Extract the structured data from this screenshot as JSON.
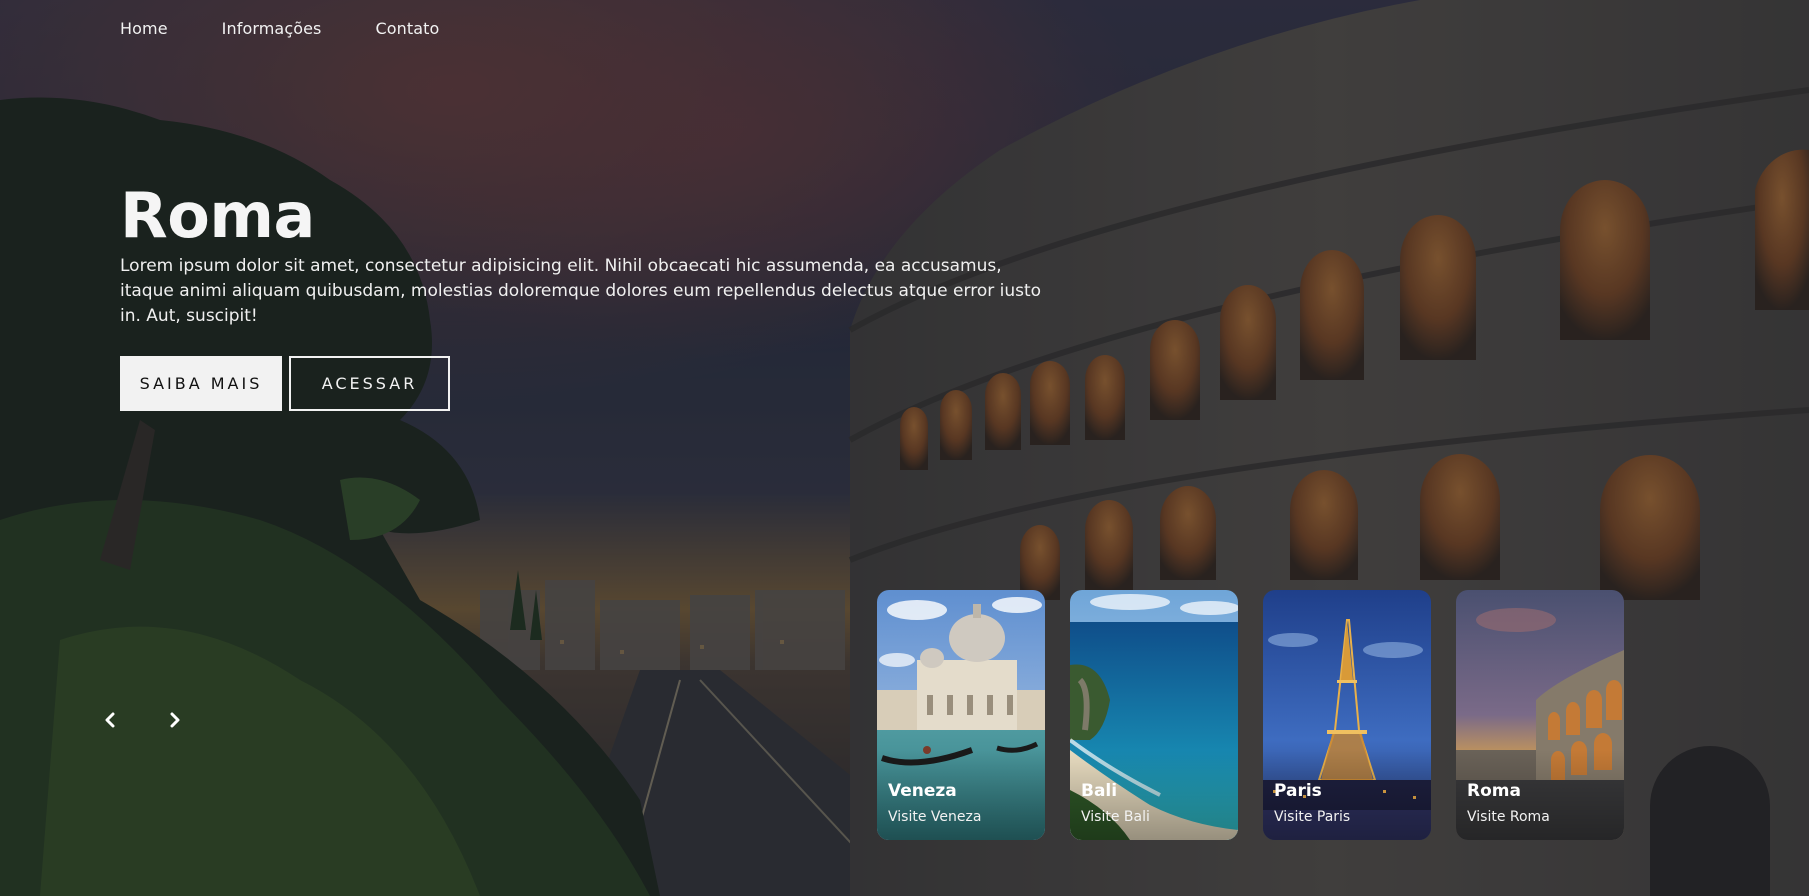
{
  "nav": {
    "items": [
      {
        "label": "Home"
      },
      {
        "label": "Informações"
      },
      {
        "label": "Contato"
      }
    ]
  },
  "hero": {
    "title": "Roma",
    "description": "Lorem ipsum dolor sit amet, consectetur adipisicing elit. Nihil obcaecati hic assumenda, ea accusamus, itaque animi aliquam quibusdam, molestias doloremque dolores eum repellendus delectus atque error iusto in. Aut, suscipit!",
    "primary_button": "SAIBA MAIS",
    "secondary_button": "ACESSAR"
  },
  "slider": {
    "prev_icon": "chevron-left-icon",
    "next_icon": "chevron-right-icon"
  },
  "cards": [
    {
      "title": "Veneza",
      "subtitle": "Visite Veneza"
    },
    {
      "title": "Bali",
      "subtitle": "Visite Bali"
    },
    {
      "title": "Paris",
      "subtitle": "Visite Paris"
    },
    {
      "title": "Roma",
      "subtitle": "Visite Roma"
    }
  ],
  "colors": {
    "text": "#f2f2f2",
    "button_bg": "#f2f2f2",
    "overlay": "#141824"
  }
}
